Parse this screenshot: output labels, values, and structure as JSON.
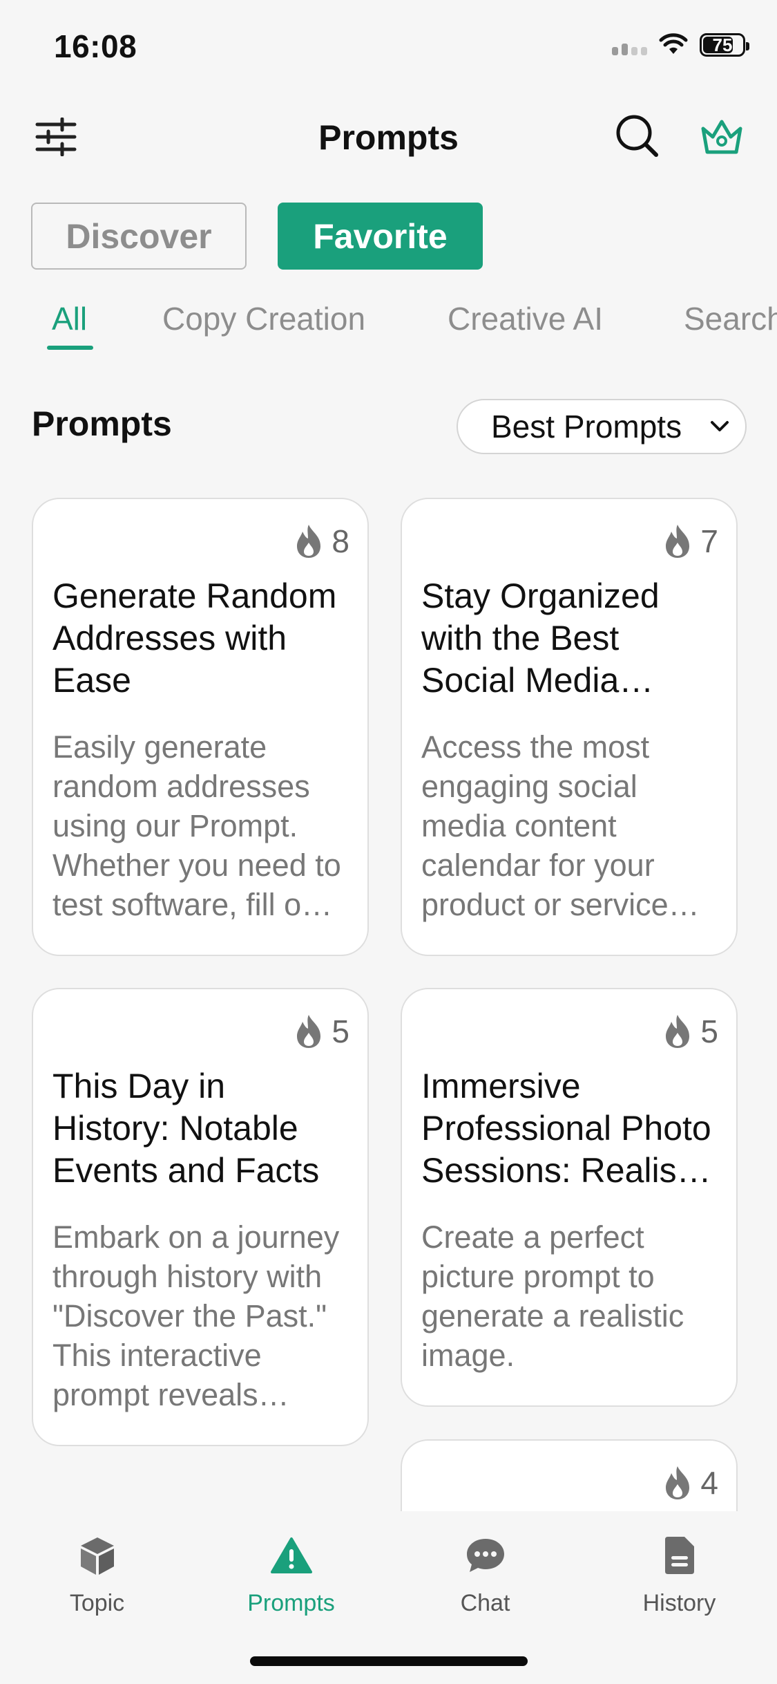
{
  "status_bar": {
    "time": "16:08",
    "battery": "75"
  },
  "header": {
    "title": "Prompts"
  },
  "segments": {
    "discover": "Discover",
    "favorite": "Favorite"
  },
  "category_tabs": [
    "All",
    "Copy Creation",
    "Creative AI",
    "Search"
  ],
  "section": {
    "title": "Prompts",
    "sort_value": "Best Prompts"
  },
  "cards": [
    {
      "count": "8",
      "title": "Generate Random Addresses with Ease",
      "description": "Easily generate random addresses using our Prompt. Whether you need to test software, fill out forms, or create mock data, our tool has you covered."
    },
    {
      "count": "7",
      "title": "Stay Organized with the Best Social Media Content Calendar",
      "description": "Access the most engaging social media content calendar for your product or service and plan ahead."
    },
    {
      "count": "5",
      "title": "This Day in History: Notable Events and Facts",
      "description": "Embark on a journey through history with \"Discover the Past.\" This interactive prompt reveals notable events."
    },
    {
      "count": "5",
      "title": "Immersive Professional Photo Sessions: Realistic Images",
      "description": "Create a perfect picture prompt to generate a realistic image."
    },
    {
      "count": "4",
      "title": "",
      "description": ""
    }
  ],
  "bottom_nav": {
    "topic": "Topic",
    "prompts": "Prompts",
    "chat": "Chat",
    "history": "History"
  },
  "colors": {
    "accent": "#1aa07c",
    "background": "#f6f6f6",
    "muted_text": "#8d8d8d"
  }
}
